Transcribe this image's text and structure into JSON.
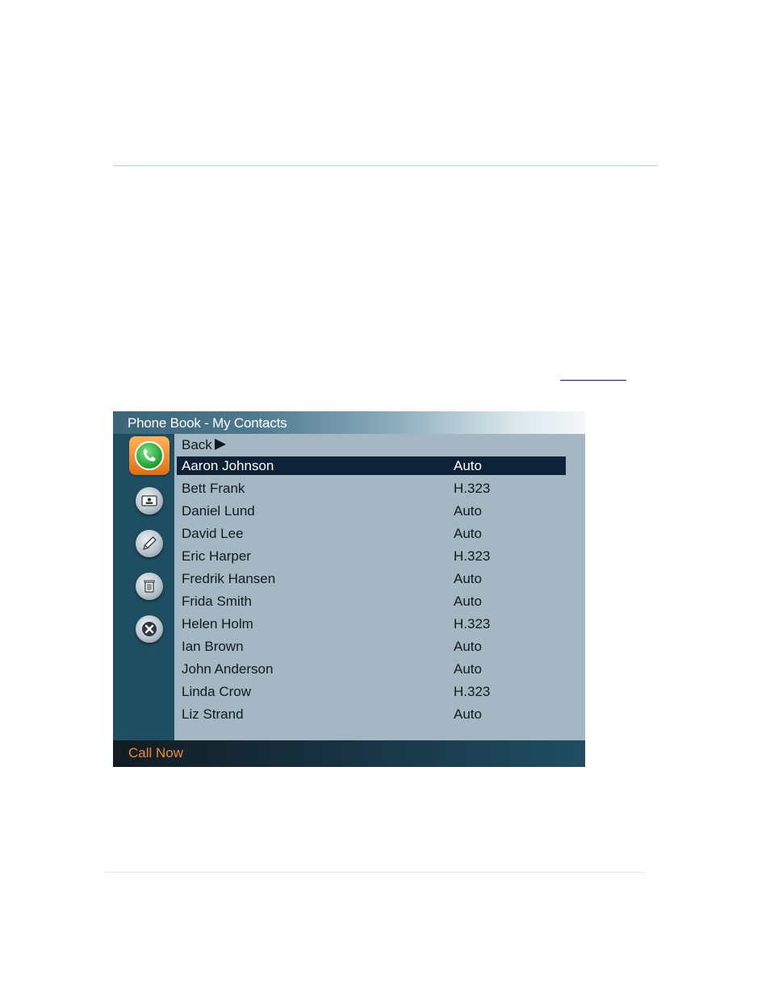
{
  "window": {
    "title": "Phone Book - My Contacts"
  },
  "list": {
    "back_label": "Back",
    "contacts": [
      {
        "name": "Aaron Johnson",
        "protocol": "Auto",
        "selected": true
      },
      {
        "name": "Bett Frank",
        "protocol": "H.323"
      },
      {
        "name": "Daniel Lund",
        "protocol": "Auto"
      },
      {
        "name": "David Lee",
        "protocol": "Auto"
      },
      {
        "name": "Eric Harper",
        "protocol": "H.323"
      },
      {
        "name": "Fredrik Hansen",
        "protocol": "Auto"
      },
      {
        "name": "Frida Smith",
        "protocol": "Auto"
      },
      {
        "name": "Helen Holm",
        "protocol": "H.323"
      },
      {
        "name": "Ian Brown",
        "protocol": "Auto"
      },
      {
        "name": "John Anderson",
        "protocol": "Auto"
      },
      {
        "name": "Linda Crow",
        "protocol": "H.323"
      },
      {
        "name": "Liz Strand",
        "protocol": "Auto"
      }
    ]
  },
  "status": {
    "hint": "Call Now"
  },
  "icons": [
    "call-icon",
    "contact-card-icon",
    "edit-pencil-icon",
    "delete-trash-icon",
    "close-icon"
  ],
  "colors": {
    "accent": "#f08a3a",
    "selection": "#0d2236",
    "list_bg": "#a6b7c4",
    "panel": "#1f4e62"
  }
}
